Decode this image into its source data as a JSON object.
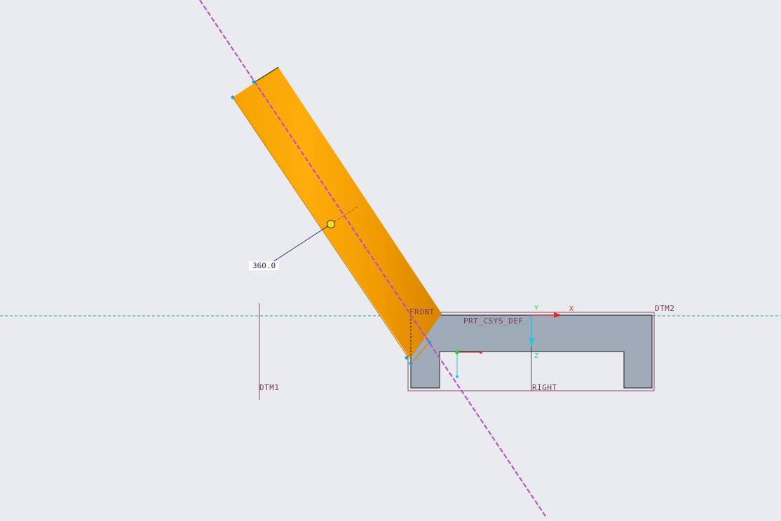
{
  "viewport": {
    "background": "#e9ebef",
    "part_color": "#a0abba",
    "cylinder_color": "#ffa500",
    "datum_axis_color": "#b44cc9",
    "datum_plane_color": "#1aa1a5",
    "label_color": "#7a3b52"
  },
  "labels": {
    "dimension": "360.0",
    "front_plane": "FRONT",
    "dtm2_plane": "DTM2",
    "csys": "PRT_CSYS_DEF",
    "right_plane": "RIGHT",
    "dtm1_plane": "DTM1",
    "axis_y": "Y",
    "axis_x": "X",
    "axis_z": "Z"
  },
  "icons": {
    "drag_handle": "circle-handle-icon",
    "csys": "coordinate-system-icon"
  }
}
